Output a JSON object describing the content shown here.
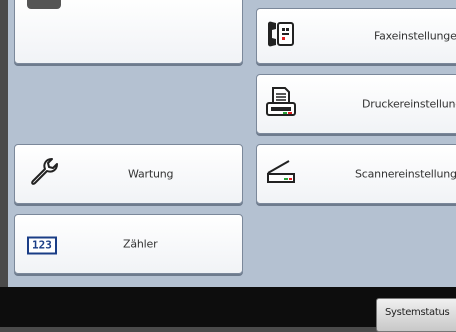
{
  "panel": {
    "left_buttons": [
      {
        "label": ""
      },
      {
        "label": "Wartung",
        "icon": "wrench-icon"
      },
      {
        "label": "Zähler",
        "icon": "counter-icon",
        "icon_text": "123"
      }
    ],
    "right_buttons": [
      {
        "label": "Faxeinstellungen",
        "icon": "fax-icon"
      },
      {
        "label": "Druckereinstellungen",
        "icon": "printer-icon"
      },
      {
        "label": "Scannereinstellungen",
        "icon": "scanner-icon"
      }
    ]
  },
  "footer": {
    "system_status_label": "Systemstatus"
  }
}
